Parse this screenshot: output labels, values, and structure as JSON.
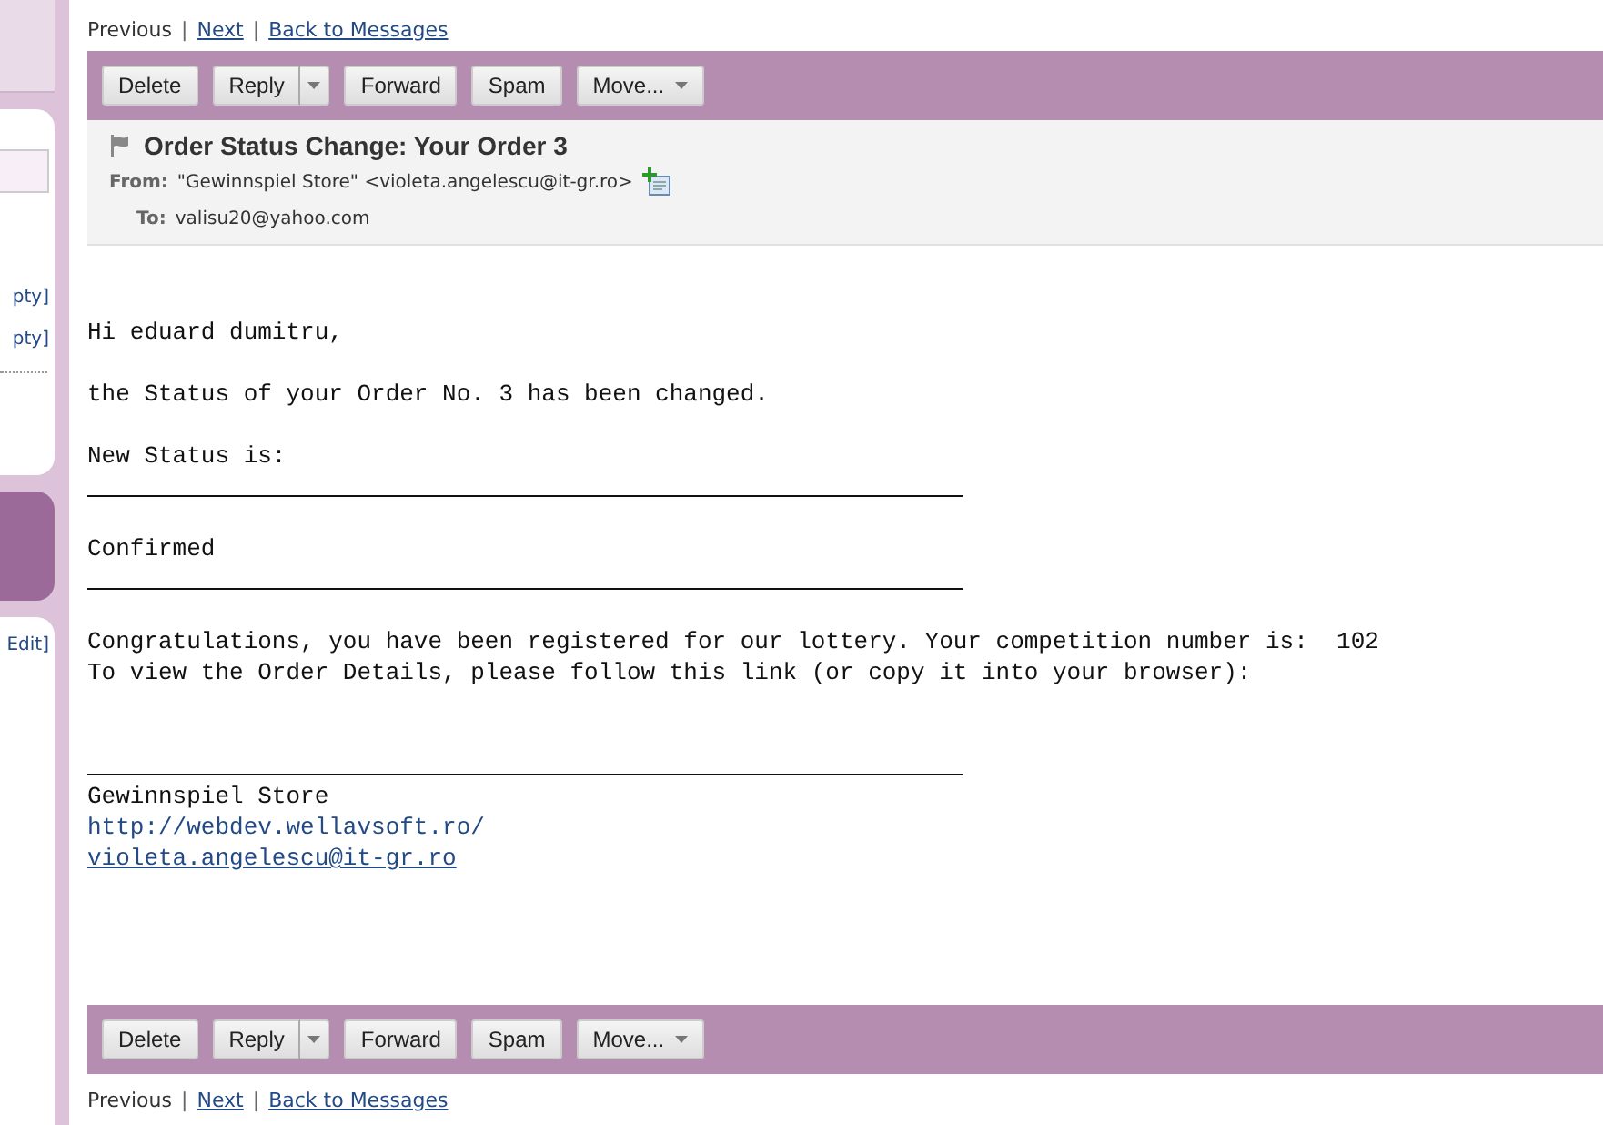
{
  "sidebar": {
    "fragments": [
      {
        "kind": "field"
      },
      {
        "kind": "text",
        "text": "pty]"
      },
      {
        "kind": "text",
        "text": "pty]"
      },
      {
        "kind": "divider"
      },
      {
        "kind": "block"
      },
      {
        "kind": "text",
        "text": "Edit]"
      }
    ]
  },
  "nav_top": [
    {
      "label": "Previous",
      "disabled": true
    },
    {
      "separator": "|",
      "label": "Next",
      "disabled": false
    },
    {
      "separator": "|",
      "label": "Back to Messages",
      "disabled": false
    }
  ],
  "toolbar_top": [
    {
      "label": "Delete",
      "kind": "plain"
    },
    {
      "label": "Reply",
      "kind": "split"
    },
    {
      "label": "Forward",
      "kind": "plain"
    },
    {
      "label": "Spam",
      "kind": "plain"
    },
    {
      "label": "Move...",
      "kind": "menu"
    }
  ],
  "message": {
    "subject": "Order Status Change: Your Order 3",
    "from_label": "From:",
    "from": "\"Gewinnspiel Store\" <violeta.angelescu@it-gr.ro>",
    "to_label": "To:",
    "to": "valisu20@yahoo.com"
  },
  "body": [
    {
      "kind": "gap"
    },
    {
      "kind": "text",
      "text": "Hi eduard dumitru,"
    },
    {
      "kind": "gap"
    },
    {
      "kind": "text",
      "text": "the Status of your Order No. 3 has been changed."
    },
    {
      "kind": "gap"
    },
    {
      "kind": "text",
      "text": "New Status is:"
    },
    {
      "kind": "rule"
    },
    {
      "kind": "gap"
    },
    {
      "kind": "text",
      "text": "Confirmed"
    },
    {
      "kind": "rule"
    },
    {
      "kind": "gap"
    },
    {
      "kind": "text",
      "text": "Congratulations, you have been registered for our lottery. Your competition number is:  102"
    },
    {
      "kind": "text",
      "text": "To view the Order Details, please follow this link (or copy it into your browser):"
    },
    {
      "kind": "gap"
    },
    {
      "kind": "gap"
    },
    {
      "kind": "rule"
    },
    {
      "kind": "text",
      "text": "Gewinnspiel Store"
    },
    {
      "kind": "link",
      "text": "http://webdev.wellavsoft.ro/",
      "underline": false
    },
    {
      "kind": "link",
      "text": "violeta.angelescu@it-gr.ro",
      "underline": true
    }
  ],
  "toolbar_bottom": [
    {
      "label": "Delete",
      "kind": "plain"
    },
    {
      "label": "Reply",
      "kind": "split"
    },
    {
      "label": "Forward",
      "kind": "plain"
    },
    {
      "label": "Spam",
      "kind": "plain"
    },
    {
      "label": "Move...",
      "kind": "menu"
    }
  ],
  "nav_bottom": [
    {
      "label": "Previous",
      "disabled": true
    },
    {
      "separator": "|",
      "label": "Next",
      "disabled": false
    },
    {
      "separator": "|",
      "label": "Back to Messages",
      "disabled": false
    }
  ]
}
